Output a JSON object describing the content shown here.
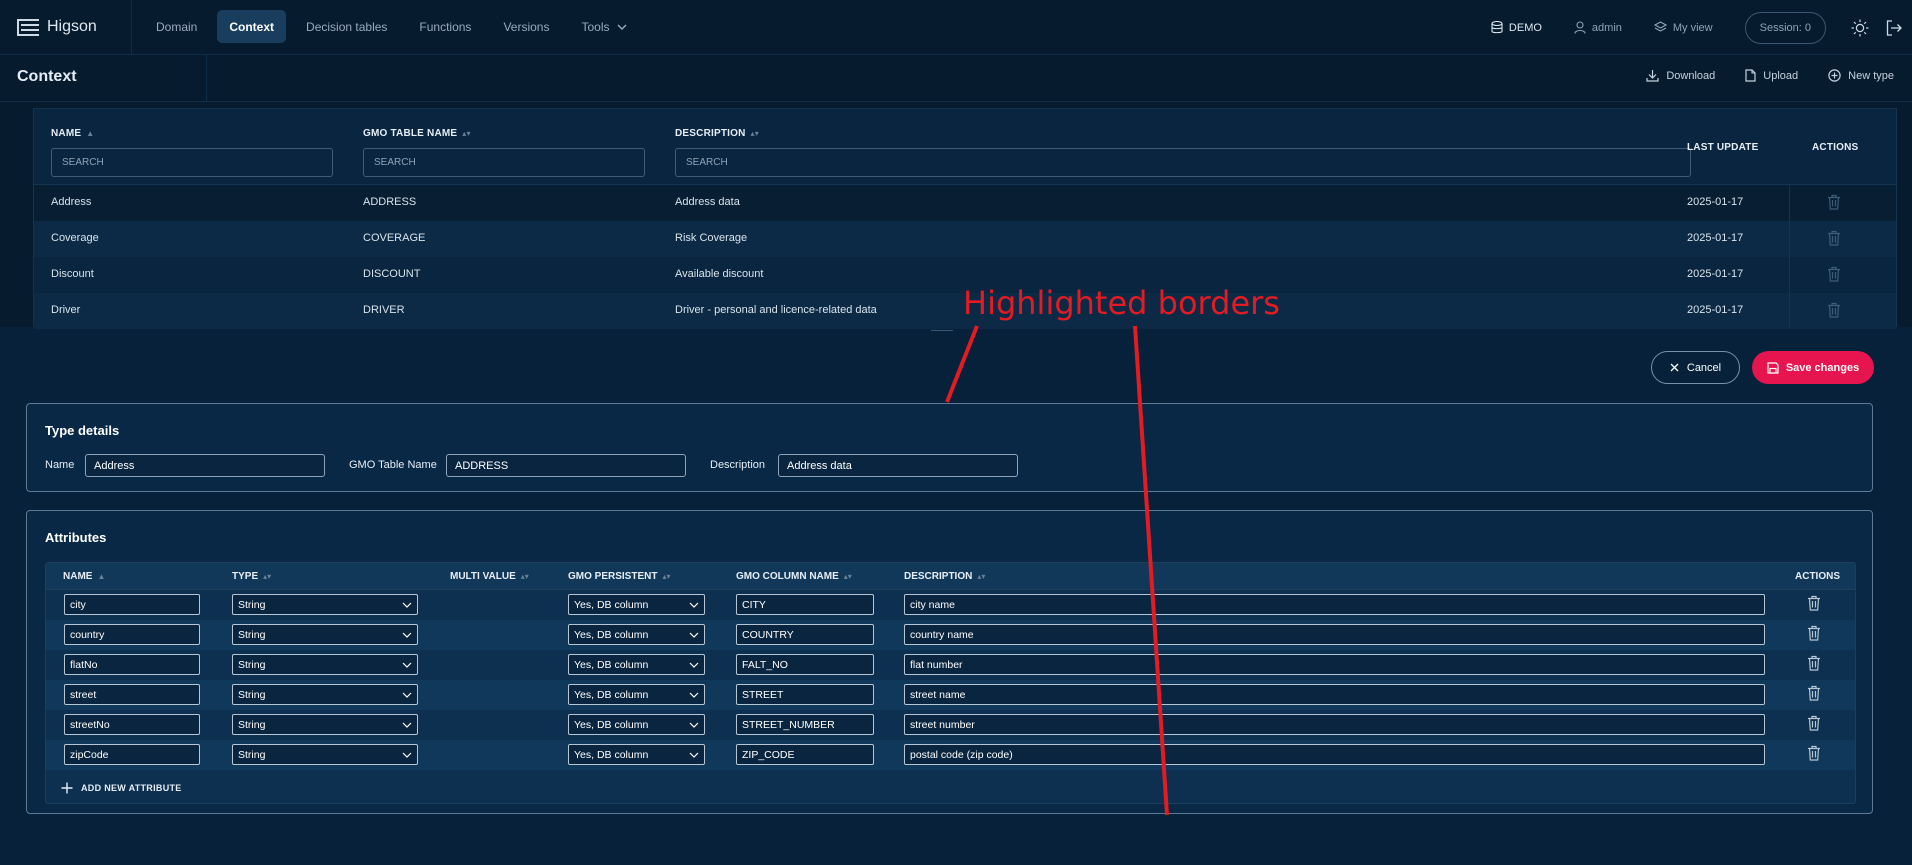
{
  "app": {
    "name": "Higson"
  },
  "nav": [
    {
      "label": "Domain",
      "active": false
    },
    {
      "label": "Context",
      "active": true
    },
    {
      "label": "Decision tables",
      "active": false
    },
    {
      "label": "Functions",
      "active": false
    },
    {
      "label": "Versions",
      "active": false
    },
    {
      "label": "Tools",
      "active": false
    }
  ],
  "topbar": {
    "environment": "DEMO",
    "user": "admin",
    "view": "My view",
    "session": "Session: 0"
  },
  "page": {
    "title": "Context",
    "actions": {
      "download": "Download",
      "upload": "Upload",
      "new_type": "New type"
    }
  },
  "types_table": {
    "headers": {
      "name": "NAME",
      "gmo_table_name": "GMO TABLE NAME",
      "description": "DESCRIPTION",
      "last_update": "LAST UPDATE",
      "actions": "ACTIONS"
    },
    "search_placeholder": "SEARCH",
    "rows": [
      {
        "name": "Address",
        "gmo": "ADDRESS",
        "description": "Address data",
        "updated": "2025-01-17"
      },
      {
        "name": "Coverage",
        "gmo": "COVERAGE",
        "description": "Risk Coverage",
        "updated": "2025-01-17"
      },
      {
        "name": "Discount",
        "gmo": "DISCOUNT",
        "description": "Available discount",
        "updated": "2025-01-17"
      },
      {
        "name": "Driver",
        "gmo": "DRIVER",
        "description": "Driver - personal and licence-related data",
        "updated": "2025-01-17"
      }
    ]
  },
  "editor": {
    "cancel": "Cancel",
    "save": "Save changes",
    "type_details": {
      "title": "Type details",
      "name_label": "Name",
      "name_value": "Address",
      "gmo_label": "GMO Table Name",
      "gmo_value": "ADDRESS",
      "description_label": "Description",
      "description_value": "Address data"
    },
    "attributes": {
      "title": "Attributes",
      "headers": {
        "name": "NAME",
        "type": "TYPE",
        "multi_value": "MULTI VALUE",
        "gmo_persistent": "GMO PERSISTENT",
        "gmo_column_name": "GMO COLUMN NAME",
        "description": "DESCRIPTION",
        "actions": "ACTIONS"
      },
      "rows": [
        {
          "name": "city",
          "type": "String",
          "persistent": "Yes, DB column",
          "column": "CITY",
          "description": "city name"
        },
        {
          "name": "country",
          "type": "String",
          "persistent": "Yes, DB column",
          "column": "COUNTRY",
          "description": "country name"
        },
        {
          "name": "flatNo",
          "type": "String",
          "persistent": "Yes, DB column",
          "column": "FALT_NO",
          "description": "flat number"
        },
        {
          "name": "street",
          "type": "String",
          "persistent": "Yes, DB column",
          "column": "STREET",
          "description": "street name"
        },
        {
          "name": "streetNo",
          "type": "String",
          "persistent": "Yes, DB column",
          "column": "STREET_NUMBER",
          "description": "street number"
        },
        {
          "name": "zipCode",
          "type": "String",
          "persistent": "Yes, DB column",
          "column": "ZIP_CODE",
          "description": "postal code  (zip code)"
        }
      ],
      "add_label": "ADD NEW ATTRIBUTE"
    }
  },
  "annotation": {
    "text": "Highlighted borders",
    "color": "#e31b23"
  },
  "colors": {
    "accent": "#e6144f",
    "background": "#062139"
  }
}
